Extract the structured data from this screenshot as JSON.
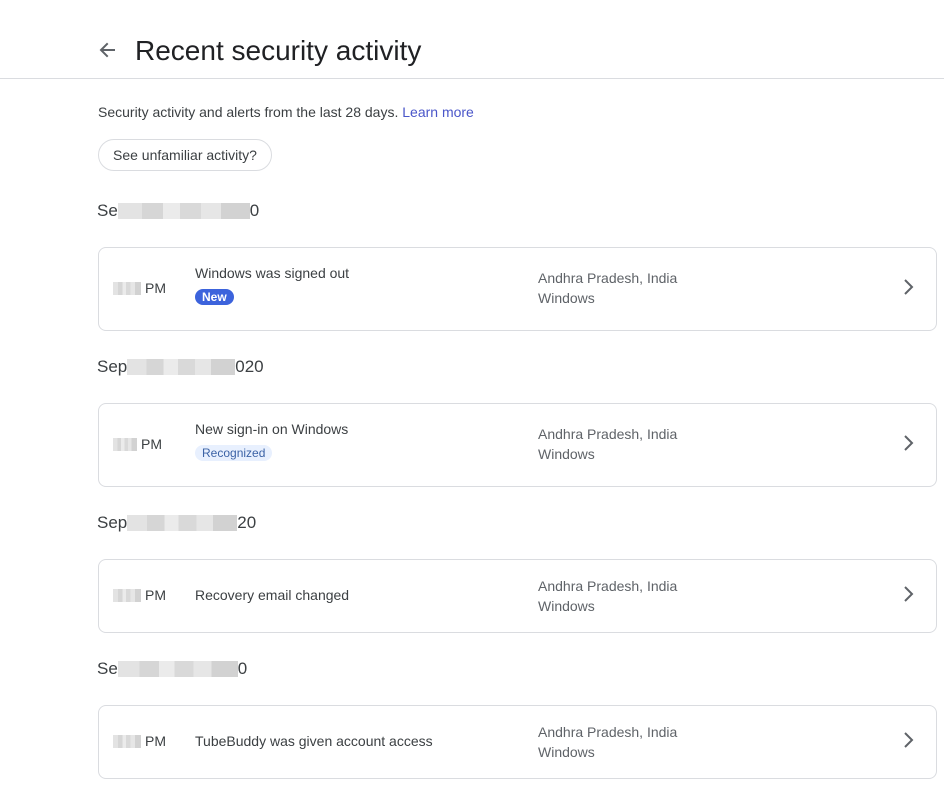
{
  "header": {
    "title": "Recent security activity",
    "back_icon": "arrow-left-icon"
  },
  "intro": {
    "text": "Security activity and alerts from the last 28 days.",
    "learn_more": "Learn more"
  },
  "unfamiliar_button": "See unfamiliar activity?",
  "groups": [
    {
      "date_prefix": "Se",
      "date_suffix": "0",
      "time_suffix": "PM",
      "title": "Windows was signed out",
      "badge": "New",
      "location": "Andhra Pradesh, India",
      "device": "Windows"
    },
    {
      "date_prefix": "Sep",
      "date_suffix": "020",
      "time_suffix": "PM",
      "title": "New sign-in on Windows",
      "badge": "Recognized",
      "location": "Andhra Pradesh, India",
      "device": "Windows"
    },
    {
      "date_prefix": "Sep",
      "date_suffix": "20",
      "time_suffix": "PM",
      "title": "Recovery email changed",
      "badge": "",
      "location": "Andhra Pradesh, India",
      "device": "Windows"
    },
    {
      "date_prefix": "Se",
      "date_suffix": "0",
      "time_suffix": "PM",
      "title": "TubeBuddy was given account access",
      "badge": "",
      "location": "Andhra Pradesh, India",
      "device": "Windows"
    }
  ],
  "colors": {
    "link": "#4a56c9",
    "badge_new_bg": "#3c63dc",
    "badge_recognized_bg": "#e8f0fe",
    "border": "#dadce0"
  }
}
